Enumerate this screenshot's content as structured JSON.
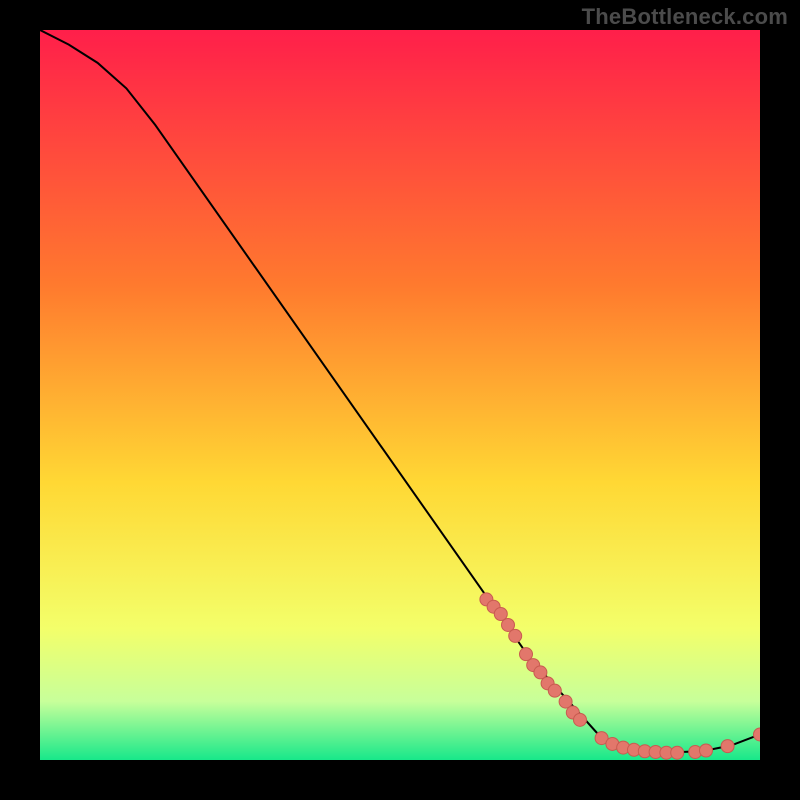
{
  "watermark": "TheBottleneck.com",
  "colors": {
    "frame": "#000000",
    "curve": "#000000",
    "dot_fill": "#e2776b",
    "dot_stroke": "#c85b50",
    "gradient_top": "#ff1f4a",
    "gradient_mid1": "#ff7a2e",
    "gradient_mid2": "#ffd834",
    "gradient_low1": "#f3ff6a",
    "gradient_low2": "#c7ff9a",
    "gradient_bottom": "#17e88a"
  },
  "chart_data": {
    "type": "line",
    "title": "",
    "xlabel": "",
    "ylabel": "",
    "xlim": [
      0,
      100
    ],
    "ylim": [
      0,
      100
    ],
    "curve": [
      {
        "x": 0,
        "y": 100
      },
      {
        "x": 4,
        "y": 98
      },
      {
        "x": 8,
        "y": 95.5
      },
      {
        "x": 12,
        "y": 92
      },
      {
        "x": 16,
        "y": 87
      },
      {
        "x": 68,
        "y": 14
      },
      {
        "x": 78,
        "y": 3
      },
      {
        "x": 82,
        "y": 1.5
      },
      {
        "x": 86,
        "y": 1
      },
      {
        "x": 92,
        "y": 1.2
      },
      {
        "x": 96,
        "y": 2
      },
      {
        "x": 100,
        "y": 3.5
      }
    ],
    "dots": [
      {
        "x": 62,
        "y": 22
      },
      {
        "x": 63,
        "y": 21
      },
      {
        "x": 64,
        "y": 20
      },
      {
        "x": 65,
        "y": 18.5
      },
      {
        "x": 66,
        "y": 17
      },
      {
        "x": 67.5,
        "y": 14.5
      },
      {
        "x": 68.5,
        "y": 13
      },
      {
        "x": 69.5,
        "y": 12
      },
      {
        "x": 70.5,
        "y": 10.5
      },
      {
        "x": 71.5,
        "y": 9.5
      },
      {
        "x": 73,
        "y": 8
      },
      {
        "x": 74,
        "y": 6.5
      },
      {
        "x": 75,
        "y": 5.5
      },
      {
        "x": 78,
        "y": 3
      },
      {
        "x": 79.5,
        "y": 2.2
      },
      {
        "x": 81,
        "y": 1.7
      },
      {
        "x": 82.5,
        "y": 1.4
      },
      {
        "x": 84,
        "y": 1.2
      },
      {
        "x": 85.5,
        "y": 1.1
      },
      {
        "x": 87,
        "y": 1.0
      },
      {
        "x": 88.5,
        "y": 1.0
      },
      {
        "x": 91,
        "y": 1.1
      },
      {
        "x": 92.5,
        "y": 1.3
      },
      {
        "x": 95.5,
        "y": 1.9
      },
      {
        "x": 100,
        "y": 3.5
      }
    ]
  }
}
